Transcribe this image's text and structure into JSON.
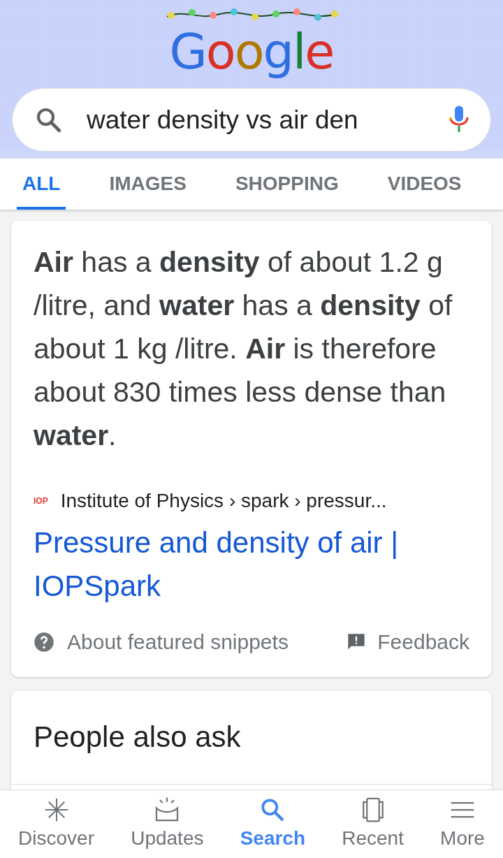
{
  "logo": "Google",
  "search": {
    "value": "water density vs air den"
  },
  "tabs": [
    {
      "label": "ALL",
      "selected": true
    },
    {
      "label": "IMAGES",
      "selected": false
    },
    {
      "label": "SHOPPING",
      "selected": false
    },
    {
      "label": "VIDEOS",
      "selected": false
    }
  ],
  "snippet": {
    "text": "**Air** has a **density** of about 1.2 g /litre, and **water** has a **density** of about 1 kg /litre. **Air** is therefore about 830 times less dense than **water**.",
    "source_logo": "IOP",
    "breadcrumb": "Institute of Physics › spark › pressur...",
    "link": "Pressure and density of air | IOPSpark",
    "about": "About featured snippets",
    "feedback": "Feedback"
  },
  "people_also_ask": {
    "title": "People also ask"
  },
  "bottom_nav": [
    {
      "label": "Discover",
      "selected": false
    },
    {
      "label": "Updates",
      "selected": false
    },
    {
      "label": "Search",
      "selected": true
    },
    {
      "label": "Recent",
      "selected": false
    },
    {
      "label": "More",
      "selected": false
    }
  ]
}
